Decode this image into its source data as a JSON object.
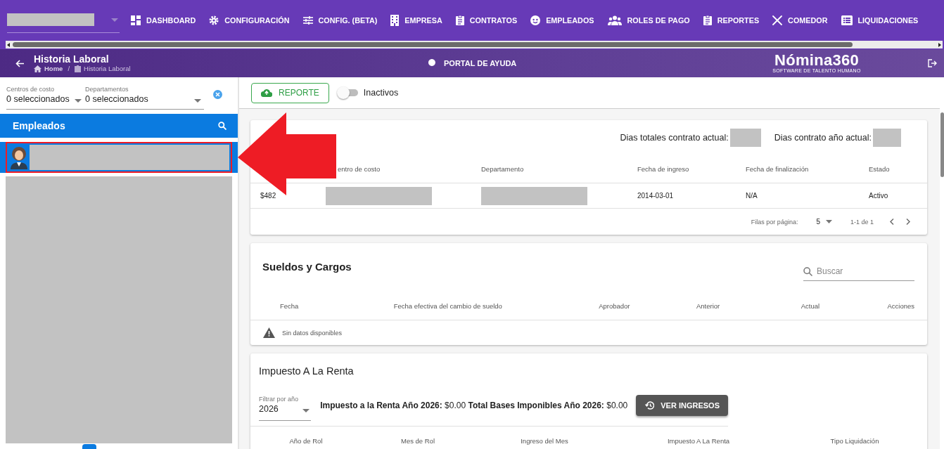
{
  "top_nav": {
    "items": [
      {
        "label": "DASHBOARD"
      },
      {
        "label": "CONFIGURACIÓN"
      },
      {
        "label": "CONFIG. (BETA)"
      },
      {
        "label": "EMPRESA"
      },
      {
        "label": "CONTRATOS"
      },
      {
        "label": "EMPLEADOS"
      },
      {
        "label": "ROLES DE PAGO"
      },
      {
        "label": "REPORTES"
      },
      {
        "label": "COMEDOR"
      },
      {
        "label": "LIQUIDACIONES"
      }
    ]
  },
  "header": {
    "title": "Historia Laboral",
    "breadcrumb": {
      "home": "Home",
      "separator": "/",
      "current": "Historia Laboral"
    },
    "help_link": "PORTAL DE AYUDA",
    "logo": {
      "name": "Nómina360",
      "tagline": "SOFTWARE DE TALENTO HUMANO"
    }
  },
  "filters": [
    {
      "label": "Centros de costo",
      "value": "0 seleccionados"
    },
    {
      "label": "Departamentos",
      "value": "0 seleccionados"
    }
  ],
  "employees": {
    "title": "Empleados",
    "items": [
      {
        "selected": true
      }
    ]
  },
  "toolbar": {
    "report_button": "REPORTE",
    "inactive_toggle": {
      "label": "Inactivos",
      "on": false
    }
  },
  "contract_card": {
    "summary": [
      "Dias totales contrato actual:",
      "Dias contrato año actual:"
    ],
    "columns": [
      "",
      "entro de costo",
      "Departamento",
      "Fecha de ingreso",
      "Fecha de finalización",
      "Estado"
    ],
    "rows": [
      {
        "cells": [
          {
            "kind": "text",
            "text": "$482"
          },
          {
            "kind": "redacted"
          },
          {
            "kind": "redacted"
          },
          {
            "kind": "text",
            "text": "2014-03-01"
          },
          {
            "kind": "text",
            "text": "N/A"
          },
          {
            "kind": "text",
            "text": "Activo"
          }
        ]
      }
    ],
    "pagination": {
      "rows_per_page_label": "Filas por página:",
      "rows_per_page": "5",
      "range": "1-1 de 1"
    }
  },
  "salary_card": {
    "title": "Sueldos y Cargos",
    "search_placeholder": "Buscar",
    "columns": [
      "Fecha",
      "Fecha efectiva del cambio de sueldo",
      "Aprobador",
      "Anterior",
      "Actual",
      "Acciones"
    ],
    "empty_message": "Sin datos disponibles"
  },
  "tax_card": {
    "title": "Impuesto A La Renta",
    "year_filter": {
      "label": "Filtrar por año",
      "value": "2026"
    },
    "summary": "**Impuesto a la Renta Año 2026:** $0.00 **Total Bases Imponibles Año 2026:** $0.00",
    "button": "VER INGRESOS",
    "columns": [
      "Año de Rol",
      "Mes de Rol",
      "Ingreso del Mes",
      "Impuesto A La Renta",
      "Tipo Liquidación"
    ]
  }
}
